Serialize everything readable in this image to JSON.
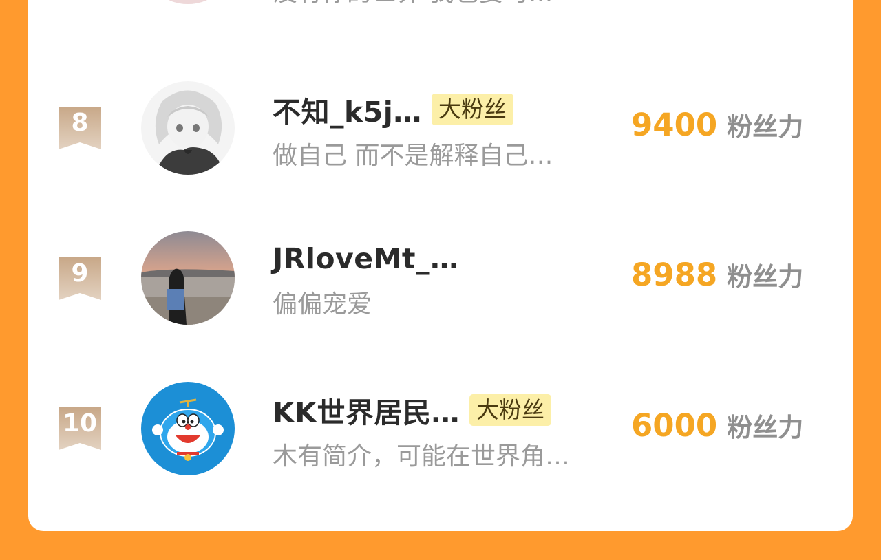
{
  "ranking": {
    "partial_top_row": {
      "bio": "没有你的世界 我也要习…"
    },
    "rows": [
      {
        "rank": "8",
        "name": "不知_k5j…",
        "tag": "大粉丝",
        "bio": "做自己 而不是解释自己…",
        "score": "9400",
        "score_unit": "粉丝力",
        "avatar": "anime-girl-avatar"
      },
      {
        "rank": "9",
        "name": "JRloveMt_…",
        "tag": "",
        "bio": "偏偏宠爱",
        "score": "8988",
        "score_unit": "粉丝力",
        "avatar": "beach-sunset-avatar"
      },
      {
        "rank": "10",
        "name": "KK世界居民…",
        "tag": "大粉丝",
        "bio": "木有简介，可能在世界角…",
        "score": "6000",
        "score_unit": "粉丝力",
        "avatar": "doraemon-avatar"
      }
    ]
  },
  "colors": {
    "background": "#FF9A2E",
    "score": "#F5A623",
    "tag_bg": "#FCEFA8",
    "rank_badge": "#D2B9A2"
  }
}
